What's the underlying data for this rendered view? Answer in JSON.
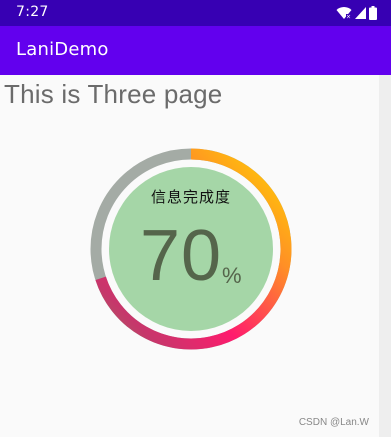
{
  "status_bar": {
    "time": "7:27",
    "icons": [
      "wifi-icon",
      "signal-icon",
      "battery-icon"
    ]
  },
  "app_bar": {
    "title": "LaniDemo",
    "color": "#6200ee",
    "status_color": "#3700b3"
  },
  "page": {
    "heading": "This is Three page"
  },
  "progress_gauge": {
    "caption": "信息完成度",
    "value": "70",
    "unit": "%",
    "percent": 0.7,
    "fill_color": "#a5d6a7",
    "track_color": "#a4aba5",
    "gradient_colors": [
      "#ffd600",
      "#ff8f26",
      "#ff1b6d",
      "#c7366b",
      "#9e6a5e"
    ]
  },
  "watermark": "CSDN @Lan.W"
}
